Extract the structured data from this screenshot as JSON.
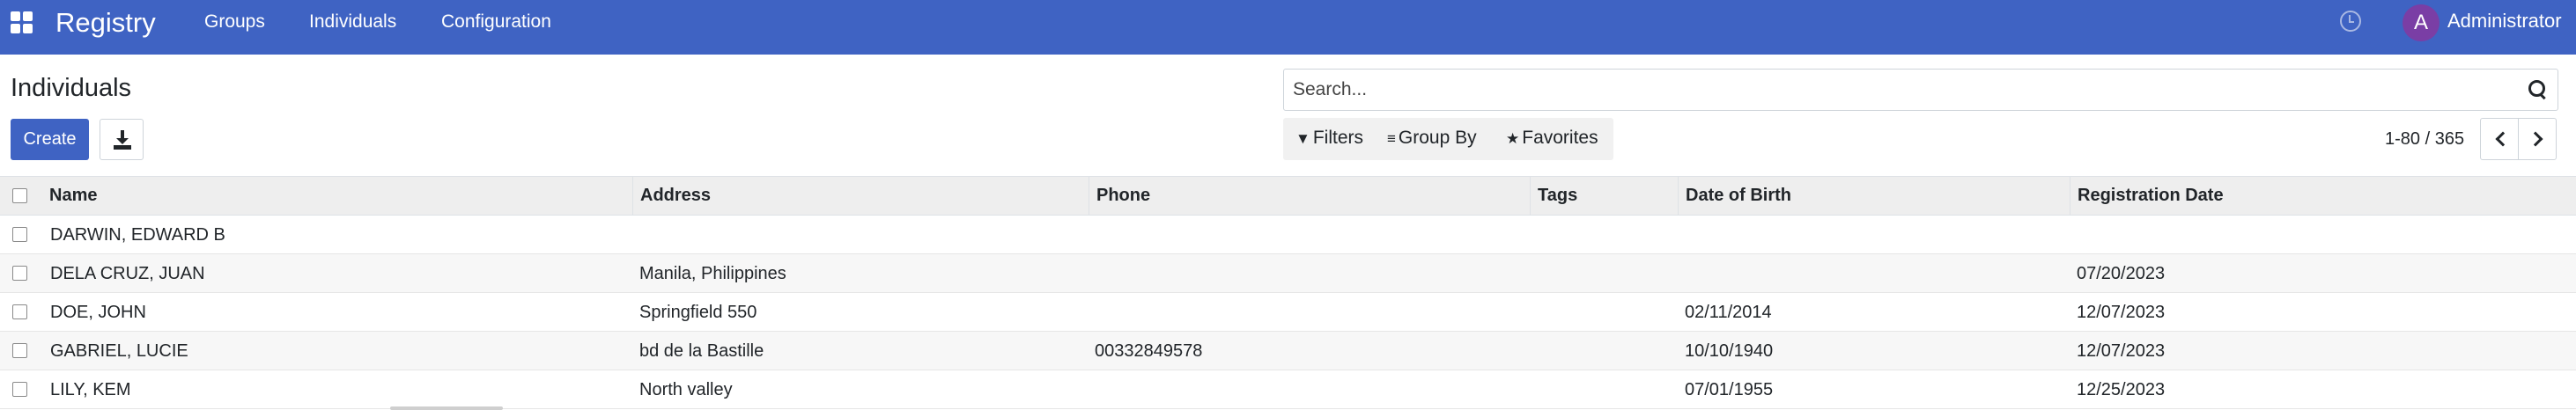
{
  "navbar": {
    "app_title": "Registry",
    "menu": [
      "Groups",
      "Individuals",
      "Configuration"
    ],
    "user": {
      "initial": "A",
      "name": "Administrator",
      "avatar_color": "#7a3ea5"
    },
    "background_color": "#3f63c3"
  },
  "control_panel": {
    "title": "Individuals",
    "create_label": "Create",
    "search_placeholder": "Search...",
    "filters_label": "Filters",
    "groupby_label": "Group By",
    "favorites_label": "Favorites",
    "pager_value": "1-80 / 365"
  },
  "table": {
    "columns": [
      "Name",
      "Address",
      "Phone",
      "Tags",
      "Date of Birth",
      "Registration Date"
    ],
    "rows": [
      {
        "name": "DARWIN, EDWARD B",
        "address": "",
        "phone": "",
        "tags": "",
        "dob": "",
        "reg_date": ""
      },
      {
        "name": "DELA CRUZ, JUAN",
        "address": "Manila, Philippines",
        "phone": "",
        "tags": "",
        "dob": "",
        "reg_date": "07/20/2023"
      },
      {
        "name": "DOE, JOHN",
        "address": "Springfield 550",
        "phone": "",
        "tags": "",
        "dob": "02/11/2014",
        "reg_date": "12/07/2023"
      },
      {
        "name": "GABRIEL, LUCIE",
        "address": "bd de la Bastille",
        "phone": "00332849578",
        "tags": "",
        "dob": "10/10/1940",
        "reg_date": "12/07/2023"
      },
      {
        "name": "LILY, KEM",
        "address": "North valley",
        "phone": "",
        "tags": "",
        "dob": "07/01/1955",
        "reg_date": "12/25/2023"
      }
    ]
  }
}
